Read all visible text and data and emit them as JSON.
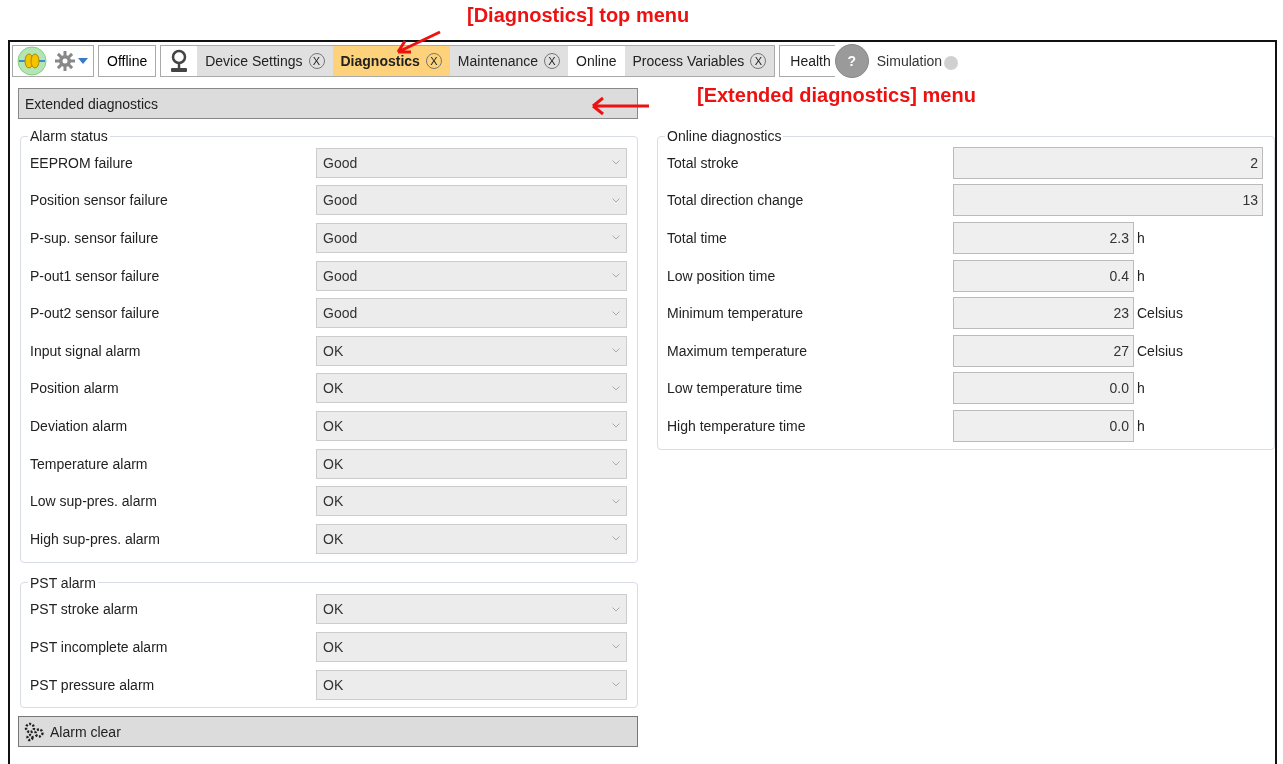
{
  "annotations": [
    {
      "text": "[Diagnostics] top menu"
    },
    {
      "text": "[Extended diagnostics] menu"
    }
  ],
  "toolbar": {
    "mode": "Offline",
    "tabs": [
      {
        "label": "Device Settings",
        "close": "X",
        "selected": false
      },
      {
        "label": "Diagnostics",
        "close": "X",
        "selected": true
      },
      {
        "label": "Maintenance",
        "close": "X",
        "selected": false
      },
      {
        "label": "Online",
        "selected": false
      },
      {
        "label": "Process Variables",
        "close": "X",
        "selected": false
      }
    ],
    "health": "Health",
    "health_icon": "?",
    "simulation": {
      "label": "Simulation",
      "on": false
    }
  },
  "menu": {
    "title": "Extended diagnostics"
  },
  "alarm_status": {
    "title": "Alarm status",
    "rows": [
      {
        "label": "EEPROM failure",
        "value": "Good"
      },
      {
        "label": "Position sensor failure",
        "value": "Good"
      },
      {
        "label": "P-sup. sensor failure",
        "value": "Good"
      },
      {
        "label": "P-out1 sensor failure",
        "value": "Good"
      },
      {
        "label": "P-out2 sensor failure",
        "value": "Good"
      },
      {
        "label": "Input signal alarm",
        "value": "OK"
      },
      {
        "label": "Position alarm",
        "value": "OK"
      },
      {
        "label": "Deviation alarm",
        "value": "OK"
      },
      {
        "label": "Temperature alarm",
        "value": "OK"
      },
      {
        "label": "Low sup-pres. alarm",
        "value": "OK"
      },
      {
        "label": "High sup-pres. alarm",
        "value": "OK"
      }
    ]
  },
  "pst_alarm": {
    "title": "PST alarm",
    "rows": [
      {
        "label": "PST stroke alarm",
        "value": "OK"
      },
      {
        "label": "PST incomplete alarm",
        "value": "OK"
      },
      {
        "label": "PST pressure alarm",
        "value": "OK"
      }
    ]
  },
  "online_diagnostics": {
    "title": "Online diagnostics",
    "rows": [
      {
        "label": "Total stroke",
        "value": "2"
      },
      {
        "label": "Total direction change",
        "value": "13"
      },
      {
        "label": "Total time",
        "value": "2.3",
        "unit": "h"
      },
      {
        "label": "Low position time",
        "value": "0.4",
        "unit": "h"
      },
      {
        "label": "Minimum temperature",
        "value": "23",
        "unit": "Celsius"
      },
      {
        "label": "Maximum temperature",
        "value": "27",
        "unit": "Celsius"
      },
      {
        "label": "Low temperature time",
        "value": "0.0",
        "unit": "h"
      },
      {
        "label": "High temperature time",
        "value": "0.0",
        "unit": "h"
      }
    ]
  },
  "alarm_clear": {
    "label": "Alarm clear"
  }
}
